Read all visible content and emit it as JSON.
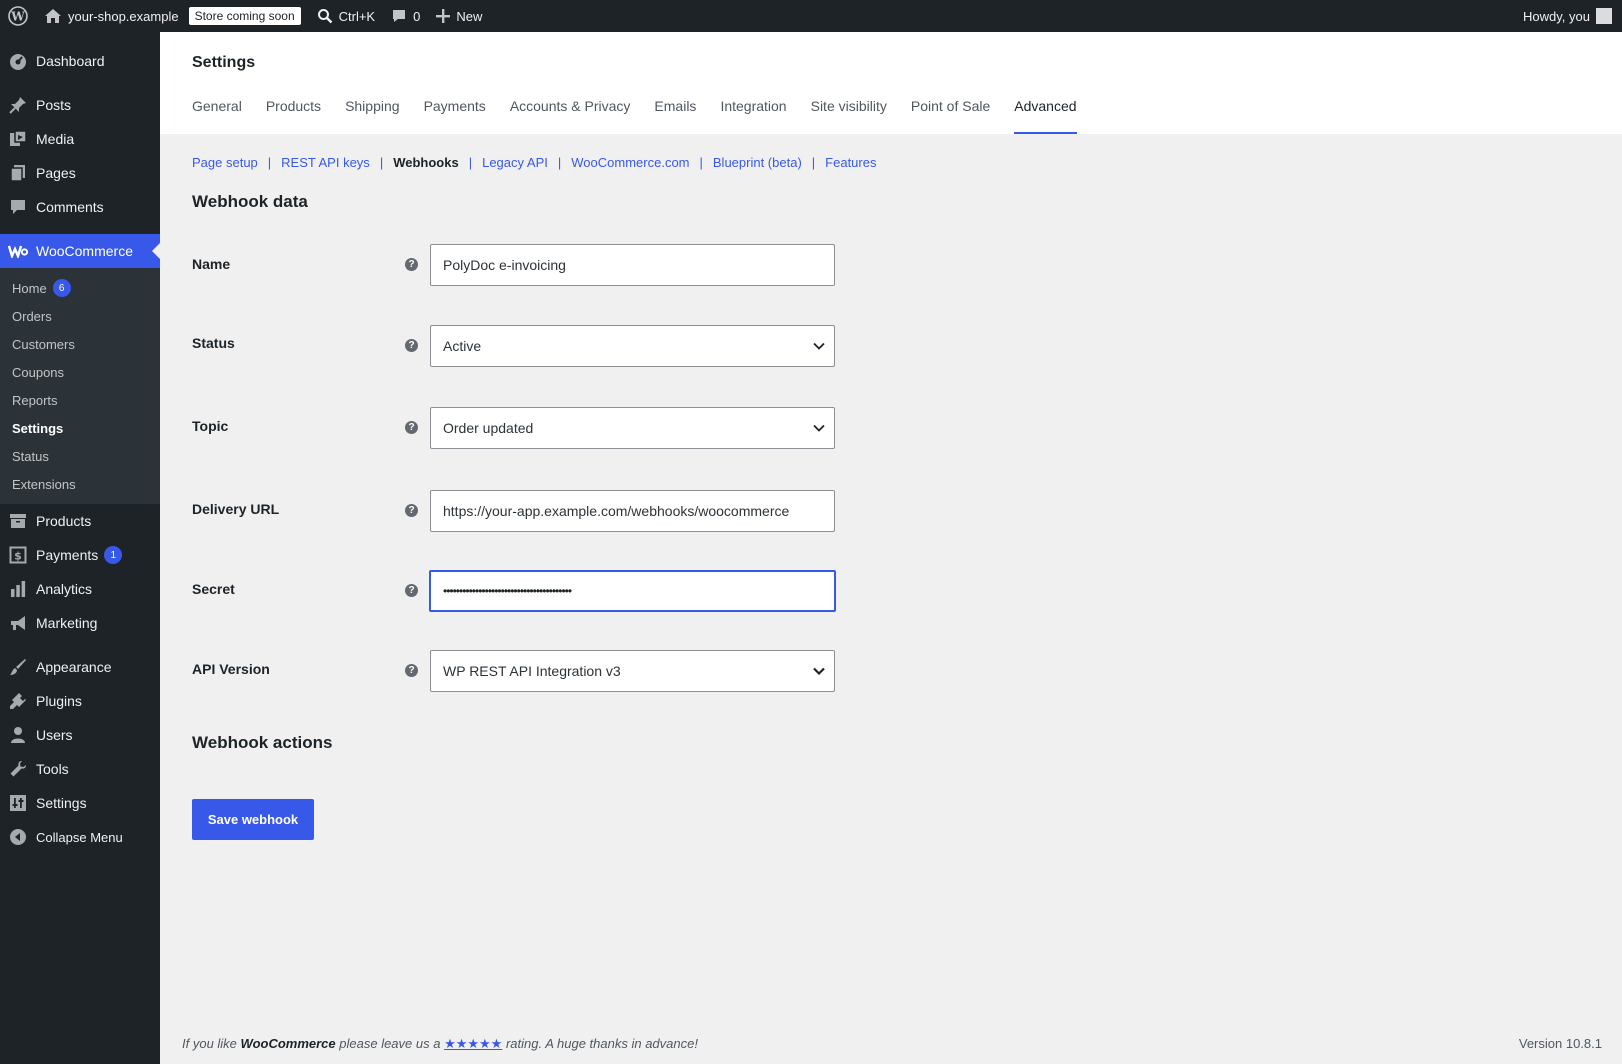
{
  "adminbar": {
    "site_name": "your-shop.example",
    "store_badge": "Store coming soon",
    "search_shortcut": "Ctrl+K",
    "comments_count": "0",
    "new_label": "New",
    "greeting": "Howdy, you"
  },
  "sidebar": {
    "dashboard": "Dashboard",
    "posts": "Posts",
    "media": "Media",
    "pages": "Pages",
    "comments": "Comments",
    "woocommerce": "WooCommerce",
    "woo_sub": {
      "home": "Home",
      "home_badge": "6",
      "orders": "Orders",
      "customers": "Customers",
      "coupons": "Coupons",
      "reports": "Reports",
      "settings": "Settings",
      "status": "Status",
      "extensions": "Extensions"
    },
    "products": "Products",
    "payments": "Payments",
    "payments_badge": "1",
    "analytics": "Analytics",
    "marketing": "Marketing",
    "appearance": "Appearance",
    "plugins": "Plugins",
    "users": "Users",
    "tools": "Tools",
    "settings": "Settings",
    "collapse": "Collapse Menu"
  },
  "header": {
    "title": "Settings",
    "tabs": [
      "General",
      "Products",
      "Shipping",
      "Payments",
      "Accounts & Privacy",
      "Emails",
      "Integration",
      "Site visibility",
      "Point of Sale",
      "Advanced"
    ]
  },
  "subnav": {
    "page_setup": "Page setup",
    "rest_api_keys": "REST API keys",
    "webhooks": "Webhooks",
    "legacy_api": "Legacy API",
    "woocommerce_com": "WooCommerce.com",
    "blueprint": "Blueprint (beta)",
    "features": "Features"
  },
  "form": {
    "section_title": "Webhook data",
    "name_label": "Name",
    "name_value": "PolyDoc e-invoicing",
    "status_label": "Status",
    "status_value": "Active",
    "topic_label": "Topic",
    "topic_value": "Order updated",
    "delivery_label": "Delivery URL",
    "delivery_value": "https://your-app.example.com/webhooks/woocommerce",
    "secret_label": "Secret",
    "secret_value": "••••••••••••••••••••••••••••••••••••••••",
    "api_label": "API Version",
    "api_value": "WP REST API Integration v3",
    "help_glyph": "?"
  },
  "actions": {
    "section_title": "Webhook actions",
    "save_label": "Save webhook"
  },
  "footer": {
    "thanks_prefix": "If you like ",
    "thanks_brand": "WooCommerce",
    "thanks_middle": " please leave us a ",
    "thanks_stars": "★★★★★",
    "thanks_suffix": " rating. A huge thanks in advance!",
    "version": "Version 10.8.1"
  },
  "colors": {
    "accent": "#3858e9",
    "admin_dark": "#1d2327",
    "background": "#f0f0f1"
  }
}
